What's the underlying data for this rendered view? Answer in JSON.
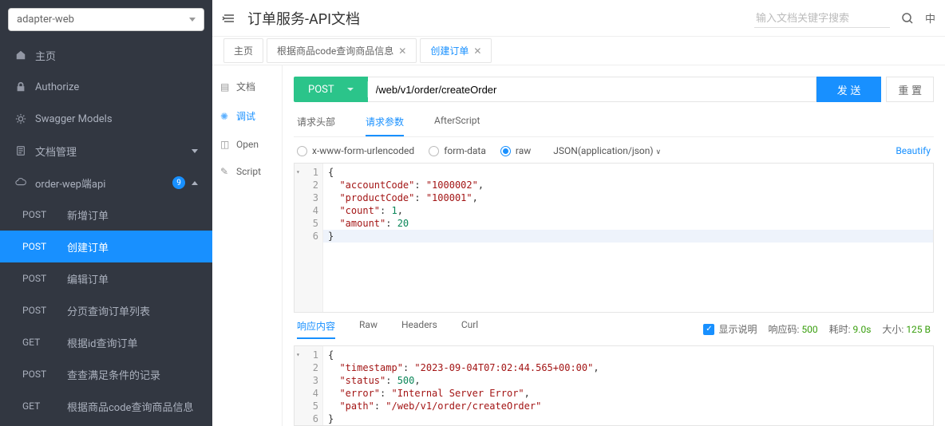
{
  "sidebar": {
    "project": "adapter-web",
    "items": [
      {
        "icon": "home",
        "label": "主页"
      },
      {
        "icon": "lock",
        "label": "Authorize"
      },
      {
        "icon": "gear",
        "label": "Swagger Models"
      },
      {
        "icon": "doc",
        "label": "文档管理",
        "expandable": true
      },
      {
        "icon": "cloud",
        "label": "order-wep端api",
        "badge": "9",
        "expandable": true,
        "open": true
      }
    ],
    "apis": [
      {
        "method": "POST",
        "label": "新增订单"
      },
      {
        "method": "POST",
        "label": "创建订单",
        "active": true
      },
      {
        "method": "POST",
        "label": "编辑订单"
      },
      {
        "method": "POST",
        "label": "分页查询订单列表"
      },
      {
        "method": "GET",
        "label": "根据id查询订单"
      },
      {
        "method": "POST",
        "label": "查查满足条件的记录"
      },
      {
        "method": "GET",
        "label": "根据商品code查询商品信息"
      }
    ]
  },
  "header": {
    "title": "订单服务-API文档",
    "search_placeholder": "输入文档关键字搜索",
    "lang": "中"
  },
  "tabs": [
    {
      "label": "主页",
      "closable": false
    },
    {
      "label": "根据商品code查询商品信息",
      "closable": true
    },
    {
      "label": "创建订单",
      "closable": true,
      "active": true
    }
  ],
  "side_tabs": [
    {
      "icon": "doc",
      "label": "文档"
    },
    {
      "icon": "bug",
      "label": "调试",
      "active": true
    },
    {
      "icon": "open",
      "label": "Open"
    },
    {
      "icon": "script",
      "label": "Script"
    }
  ],
  "request": {
    "method": "POST",
    "url": "/web/v1/order/createOrder",
    "send_label": "发 送",
    "reset_label": "重 置",
    "subtabs": [
      {
        "label": "请求头部"
      },
      {
        "label": "请求参数",
        "active": true
      },
      {
        "label": "AfterScript"
      }
    ],
    "body_types": {
      "urlencoded": "x-www-form-urlencoded",
      "formdata": "form-data",
      "raw": "raw"
    },
    "content_type": "JSON(application/json)",
    "beautify": "Beautify",
    "body_lines": [
      "{",
      "  \"accountCode\": \"1000002\",",
      "  \"productCode\": \"100001\",",
      "  \"count\": 1,",
      "  \"amount\": 20",
      "}"
    ]
  },
  "response": {
    "tabs": [
      {
        "label": "响应内容",
        "active": true
      },
      {
        "label": "Raw"
      },
      {
        "label": "Headers"
      },
      {
        "label": "Curl"
      }
    ],
    "show_desc_label": "显示说明",
    "code_label": "响应码:",
    "code": "500",
    "time_label": "耗时:",
    "time": "9.0s",
    "size_label": "大小:",
    "size": "125 B",
    "body_lines": [
      "{",
      "  \"timestamp\": \"2023-09-04T07:02:44.565+00:00\",",
      "  \"status\": 500,",
      "  \"error\": \"Internal Server Error\",",
      "  \"path\": \"/web/v1/order/createOrder\"",
      "}"
    ]
  }
}
